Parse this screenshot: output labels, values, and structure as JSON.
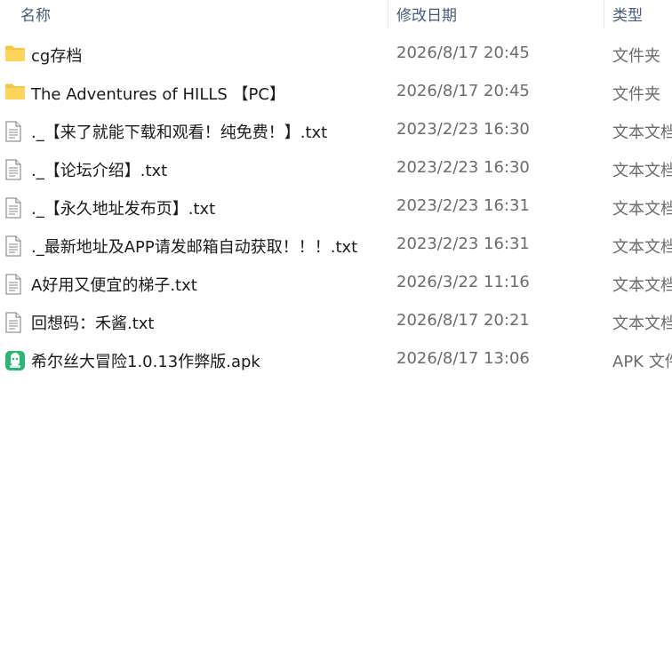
{
  "header": {
    "name": "名称",
    "date": "修改日期",
    "type": "类型"
  },
  "files": [
    {
      "name": "cg存档",
      "date": "2026/8/17 20:45",
      "type": "文件夹",
      "icon": "folder-icon"
    },
    {
      "name": "The Adventures of HILLS 【PC】",
      "date": "2026/8/17 20:45",
      "type": "文件夹",
      "icon": "folder-icon"
    },
    {
      "name": "._【来了就能下载和观看！纯免费！】.txt",
      "date": "2023/2/23 16:30",
      "type": "文本文档",
      "icon": "text-file-icon"
    },
    {
      "name": "._【论坛介绍】.txt",
      "date": "2023/2/23 16:30",
      "type": "文本文档",
      "icon": "text-file-icon"
    },
    {
      "name": "._【永久地址发布页】.txt",
      "date": "2023/2/23 16:31",
      "type": "文本文档",
      "icon": "text-file-icon"
    },
    {
      "name": "._最新地址及APP请发邮箱自动获取！！！.txt",
      "date": "2023/2/23 16:31",
      "type": "文本文档",
      "icon": "text-file-icon"
    },
    {
      "name": "A好用又便宜的梯子.txt",
      "date": "2026/3/22 11:16",
      "type": "文本文档",
      "icon": "text-file-icon"
    },
    {
      "name": "回想码：禾酱.txt",
      "date": "2026/8/17 20:21",
      "type": "文本文档",
      "icon": "text-file-icon"
    },
    {
      "name": "希尔丝大冒险1.0.13作弊版.apk",
      "date": "2026/8/17 13:06",
      "type": "APK 文件",
      "icon": "apk-file-icon"
    }
  ],
  "colors": {
    "folder": "#f4c542",
    "apk": "#2bb673"
  }
}
